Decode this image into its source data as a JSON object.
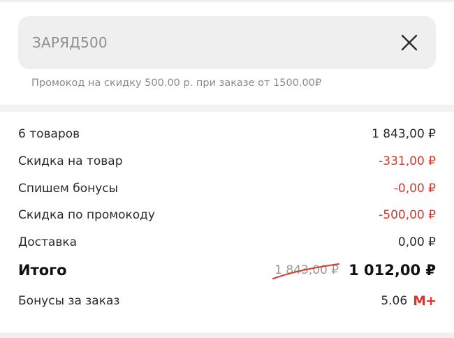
{
  "promo": {
    "code": "ЗАРЯД500",
    "hint": "Промокод на скидку 500.00 р. при заказе от 1500.00₽"
  },
  "summary": {
    "rows": [
      {
        "label": "6 товаров",
        "value": "1 843,00 ₽"
      },
      {
        "label": "Скидка на товар",
        "value": "-331,00 ₽"
      },
      {
        "label": "Спишем бонусы",
        "value": "-0,00 ₽"
      },
      {
        "label": "Скидка по промокоду",
        "value": "-500,00 ₽"
      },
      {
        "label": "Доставка",
        "value": "0,00 ₽"
      }
    ],
    "total": {
      "label": "Итого",
      "old_price": "1 843,00 ₽",
      "value": "1 012,00 ₽"
    },
    "bonus": {
      "label": "Бонусы за заказ",
      "value": "5.06",
      "badge": "М+"
    }
  },
  "colors": {
    "accent_red": "#d53a2e",
    "muted": "#8a8a8a"
  },
  "icons": {
    "clear": "close-icon",
    "bonus": "m-plus-icon"
  }
}
